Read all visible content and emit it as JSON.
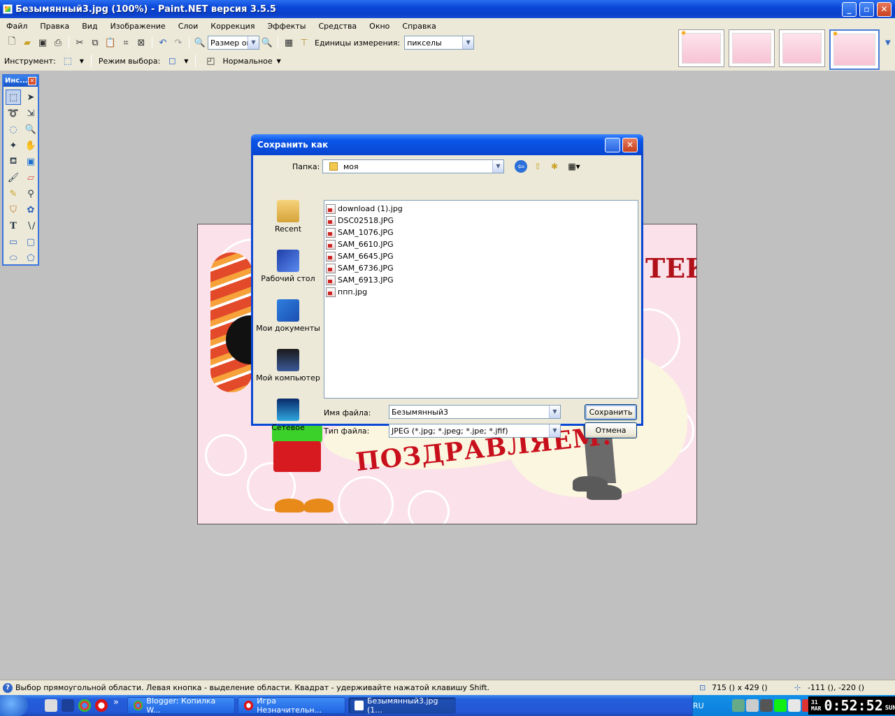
{
  "window": {
    "title": "Безымянный3.jpg (100%) - Paint.NET версия 3.5.5"
  },
  "menu": [
    "Файл",
    "Правка",
    "Вид",
    "Изображение",
    "Слои",
    "Коррекция",
    "Эффекты",
    "Средства",
    "Окно",
    "Справка"
  ],
  "toolbar": {
    "zoom_value": "Размер окн",
    "units_label": "Единицы измерения:",
    "units_value": "пикселы",
    "tool_label": "Инструмент:",
    "selection_mode_label": "Режим выбора:",
    "blend_mode": "Нормальное"
  },
  "tools_panel": {
    "title": "Инс..."
  },
  "canvas_text": {
    "top": "ТЕК",
    "greeting": "ПОЗДРАВЛЯЕМ!"
  },
  "dialog": {
    "title": "Сохранить как",
    "folder_label": "Папка:",
    "folder_value": "моя",
    "places": [
      "Recent",
      "Рабочий стол",
      "Мои документы",
      "Мой компьютер",
      "Сетевое"
    ],
    "files": [
      "download (1).jpg",
      "DSC02518.JPG",
      "SAM_1076.JPG",
      "SAM_6610.JPG",
      "SAM_6645.JPG",
      "SAM_6736.JPG",
      "SAM_6913.JPG",
      "ппп.jpg"
    ],
    "filename_label": "Имя файла:",
    "filename_value": "Безымянный3",
    "filetype_label": "Тип файла:",
    "filetype_value": "JPEG (*.jpg; *.jpeg; *.jpe; *.jfif)",
    "save_label": "Сохранить",
    "cancel_label": "Отмена"
  },
  "status": {
    "hint": "Выбор прямоугольной области. Левая кнопка - выделение области. Квадрат - удерживайте нажатой клавишу Shift.",
    "size": "715 () x 429 ()",
    "coords": "-111 (), -220 ()"
  },
  "taskbar": {
    "more": "»",
    "tasks": [
      "Blogger: Копилка W...",
      "Игра Незначительн...",
      "Безымянный3.jpg (1..."
    ],
    "lang": "RU",
    "clock_day": "31",
    "clock_month": "MAR",
    "clock_time": "0:52:52",
    "clock_weekday": "SUN"
  }
}
